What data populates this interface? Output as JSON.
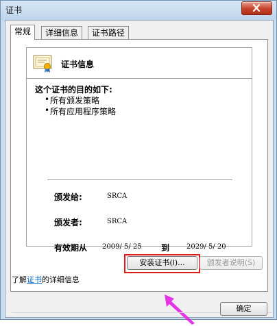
{
  "window": {
    "title": "证书"
  },
  "tabs": [
    {
      "label": "常规"
    },
    {
      "label": "详细信息"
    },
    {
      "label": "证书路径"
    }
  ],
  "cert": {
    "heading": "证书信息",
    "purpose_title": "这个证书的目的如下:",
    "purposes": [
      "所有颁发策略",
      "所有应用程序策略"
    ],
    "issued_to_label": "颁发给:",
    "issued_to_value": "SRCA",
    "issued_by_label": "颁发者:",
    "issued_by_value": "SRCA",
    "valid_from_label": "有效期从",
    "valid_from_value": "2009/ 5/ 25",
    "valid_to_label": "到",
    "valid_to_value": "2029/ 5/ 20"
  },
  "buttons": {
    "install_label": "安装证书(I)...",
    "issuer_statement_label": "颁发者说明(S)",
    "ok_label": "确定"
  },
  "learn_more": {
    "prefix": "了解",
    "link_text": "证书",
    "suffix": "的详细信息"
  },
  "colors": {
    "highlight_box": "#e11919",
    "annotation_arrow": "#e434e6",
    "link": "#0066cc",
    "close_button": "#c7412a"
  },
  "icons": {
    "close": "close-icon",
    "certificate": "certificate-icon",
    "annotation": "arrow-annotation-icon"
  }
}
